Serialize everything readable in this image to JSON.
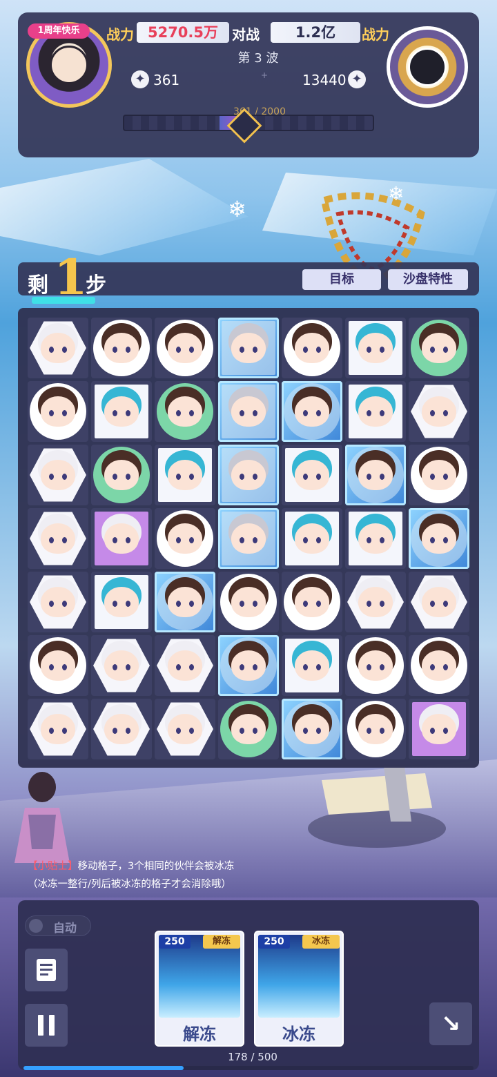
{
  "header": {
    "anniversary_badge": "1周年快乐",
    "power_label": "战力",
    "player_power": "5270.5万",
    "battle_label": "对战",
    "enemy_power": "1.2亿",
    "enemy_power_label": "战力",
    "wave": "第 3 波",
    "player_count": "361",
    "enemy_count": "13440",
    "progress_text": "361 / 2000",
    "progress": 0.18
  },
  "steps": {
    "left": "剩",
    "number": "1",
    "right": "步"
  },
  "tabs": {
    "goal": "目标",
    "sandbox": "沙盘特性"
  },
  "board": {
    "rows": [
      [
        "white-hex",
        "brown-circle",
        "brown-circle",
        "gray-ice",
        "brown-circle",
        "cyan-square",
        "brown-circle"
      ],
      [
        "brown-circle",
        "cyan-square",
        "brown-circle",
        "gray-ice",
        "brown-ice",
        "cyan-square",
        "white-hex"
      ],
      [
        "white-hex",
        "brown-circle",
        "cyan-square",
        "gray-ice",
        "cyan-square",
        "brown-ice",
        "brown-circle"
      ],
      [
        "white-hex",
        "special-square",
        "brown-circle",
        "gray-ice",
        "cyan-square",
        "cyan-square",
        "brown-ice"
      ],
      [
        "white-hex",
        "cyan-square",
        "brown-ice",
        "brown-circle",
        "brown-circle",
        "white-hex",
        "white-hex"
      ],
      [
        "brown-circle",
        "white-hex",
        "white-hex",
        "brown-ice",
        "cyan-square",
        "brown-circle",
        "brown-circle"
      ],
      [
        "white-hex",
        "white-hex",
        "white-hex",
        "brown-circle",
        "brown-ice",
        "brown-circle",
        "special-square"
      ]
    ]
  },
  "tip": {
    "tag": "【小贴士】",
    "line1": "移动格子，3个相同的伙伴会被冰冻",
    "line2": "（冰冻一整行/列后被冰冻的格子才会消除哦）"
  },
  "controls": {
    "auto_label": "自动",
    "skills": [
      {
        "cost": "250",
        "type": "解冻",
        "name": "解冻"
      },
      {
        "cost": "250",
        "type": "冰冻",
        "name": "冰冻"
      }
    ],
    "energy_text": "178 / 500",
    "energy": 0.356
  },
  "colors": {
    "panel": "#343658",
    "gold": "#f5c54d",
    "accent_red": "#e8405a",
    "ice": "#3e86d8"
  }
}
